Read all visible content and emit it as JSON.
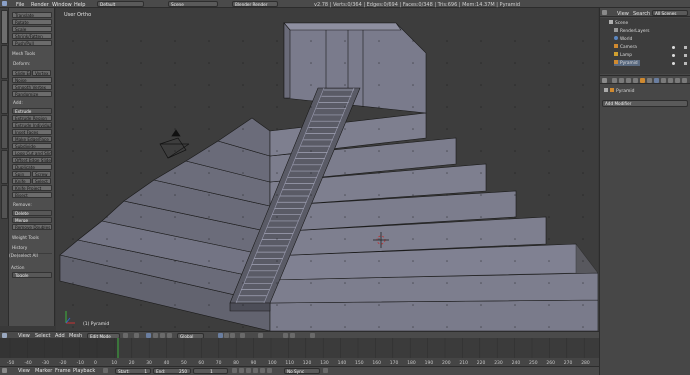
{
  "info_header": {
    "menus": [
      "File",
      "Render",
      "Window",
      "Help"
    ],
    "layout": "Default",
    "scene": "Scene",
    "engine": "Blender Render",
    "stats": "v2.78 | Verts:0/364 | Edges:0/694 | Faces:0/348 | Tris:696 | Mem:14.37M | Pyramid"
  },
  "toolbar": {
    "tabs": [
      "Tools",
      "Create",
      "Relations",
      "Shading / UVs",
      "Options",
      "Grease Pencil"
    ],
    "transform_buttons": [
      "Translate",
      "Rotate",
      "Scale",
      "Shrink/Fatten",
      "Push/Pull"
    ],
    "mesh_tools": "Mesh Tools",
    "deform_label": "Deform:",
    "deform_pair": [
      "Slide Ed",
      "Vertex"
    ],
    "deform_buttons": [
      "Noise",
      "Smooth Vertex",
      "Randomize"
    ],
    "add_label": "Add:",
    "extrude_label": "Extrude",
    "add_buttons": [
      "Extrude Region",
      "Extrude Individual",
      "Inset Faces",
      "Make Edge/Face",
      "Subdivide",
      "Loop Cut and Slide",
      "Offset Edge Slide",
      "Duplicate"
    ],
    "spin_pair": [
      "Spin",
      "Screw"
    ],
    "knife_pair": [
      "Knife",
      "Select"
    ],
    "add_buttons2": [
      "Knife Project",
      "Bisect"
    ],
    "remove_label": "Remove:",
    "delete_label": "Delete",
    "merge_label": "Merge",
    "remove_doubles": "Remove Doubles",
    "weight_tools": "Weight Tools",
    "history": "History",
    "operator": "(De)select All",
    "action_label": "Action",
    "action_value": "Toggle"
  },
  "viewport": {
    "view_name": "User Ortho",
    "object_label": "(1) Pyramid"
  },
  "view3d_header": {
    "menus": [
      "View",
      "Select",
      "Add",
      "Mesh"
    ],
    "mode": "Edit Mode",
    "orientation": "Global"
  },
  "outliner": {
    "menus": [
      "View",
      "Search"
    ],
    "filter": "All Scenes",
    "rows": [
      "Scene",
      "RenderLayers",
      "World",
      "Camera",
      "Lamp",
      "Pyramid"
    ]
  },
  "properties": {
    "context_object": "Pyramid",
    "add_modifier": "Add Modifier"
  },
  "timeline": {
    "ticks": [
      "-50",
      "-40",
      "-30",
      "-20",
      "-10",
      "0",
      "10",
      "20",
      "30",
      "40",
      "50",
      "60",
      "70",
      "80",
      "90",
      "100",
      "110",
      "120",
      "130",
      "140",
      "150",
      "160",
      "170",
      "180",
      "190",
      "200",
      "210",
      "220",
      "230",
      "240",
      "250",
      "260",
      "270",
      "280"
    ],
    "current_frame": 1
  },
  "timeline_footer": {
    "menus": [
      "View",
      "Marker",
      "Frame",
      "Playback"
    ],
    "start": "Start:",
    "start_value": "1",
    "end": "End:",
    "end_value": "250",
    "frame_value": "1",
    "sync": "No Sync"
  }
}
